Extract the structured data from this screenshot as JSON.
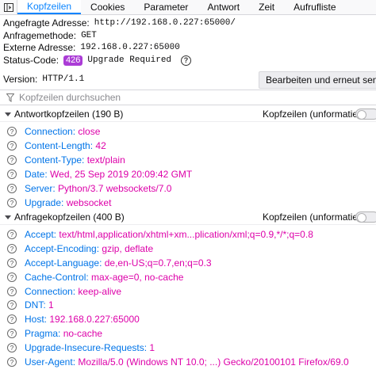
{
  "tabs": [
    {
      "label": "Kopfzeilen",
      "active": true
    },
    {
      "label": "Cookies",
      "active": false
    },
    {
      "label": "Parameter",
      "active": false
    },
    {
      "label": "Antwort",
      "active": false
    },
    {
      "label": "Zeit",
      "active": false
    },
    {
      "label": "Aufrufliste",
      "active": false
    }
  ],
  "summary": {
    "requested_address_label": "Angefragte Adresse:",
    "requested_address_value": "http://192.168.0.227:65000/",
    "method_label": "Anfragemethode:",
    "method_value": "GET",
    "remote_address_label": "Externe Adresse:",
    "remote_address_value": "192.168.0.227:65000",
    "status_code_label": "Status-Code:",
    "status_code_value": "426",
    "status_text": "Upgrade Required",
    "version_label": "Version:",
    "version_value": "HTTP/1.1",
    "resend_button": "Bearbeiten und erneut senden"
  },
  "filter": {
    "placeholder": "Kopfzeilen durchsuchen"
  },
  "response_headers": {
    "title": "Antwortkopfzeilen (190 B)",
    "raw_toggle_label": "Kopfzeilen (unformatiert)",
    "rows": [
      {
        "name": "Connection:",
        "value": "close"
      },
      {
        "name": "Content-Length:",
        "value": "42"
      },
      {
        "name": "Content-Type:",
        "value": "text/plain"
      },
      {
        "name": "Date:",
        "value": "Wed, 25 Sep 2019 20:09:42 GMT"
      },
      {
        "name": "Server:",
        "value": "Python/3.7 websockets/7.0"
      },
      {
        "name": "Upgrade:",
        "value": "websocket"
      }
    ]
  },
  "request_headers": {
    "title": "Anfragekopfzeilen (400 B)",
    "raw_toggle_label": "Kopfzeilen (unformatiert)",
    "rows": [
      {
        "name": "Accept:",
        "value": "text/html,application/xhtml+xm...plication/xml;q=0.9,*/*;q=0.8"
      },
      {
        "name": "Accept-Encoding:",
        "value": "gzip, deflate"
      },
      {
        "name": "Accept-Language:",
        "value": "de,en-US;q=0.7,en;q=0.3"
      },
      {
        "name": "Cache-Control:",
        "value": "max-age=0, no-cache"
      },
      {
        "name": "Connection:",
        "value": "keep-alive"
      },
      {
        "name": "DNT:",
        "value": "1"
      },
      {
        "name": "Host:",
        "value": "192.168.0.227:65000"
      },
      {
        "name": "Pragma:",
        "value": "no-cache"
      },
      {
        "name": "Upgrade-Insecure-Requests:",
        "value": "1"
      },
      {
        "name": "User-Agent:",
        "value": "Mozilla/5.0 (Windows NT 10.0; ...) Gecko/20100101 Firefox/69.0"
      }
    ]
  },
  "icons": {
    "panel_toggle": "panel-toggle-icon",
    "help": "help-icon",
    "filter": "filter-icon",
    "twisty": "twisty-down-icon",
    "header_help": "question-circle-icon"
  },
  "colors": {
    "accent": "#0a84ff",
    "header_name": "#0074e8",
    "header_value": "#dd00a9",
    "status_badge": "#ab3cd6"
  }
}
